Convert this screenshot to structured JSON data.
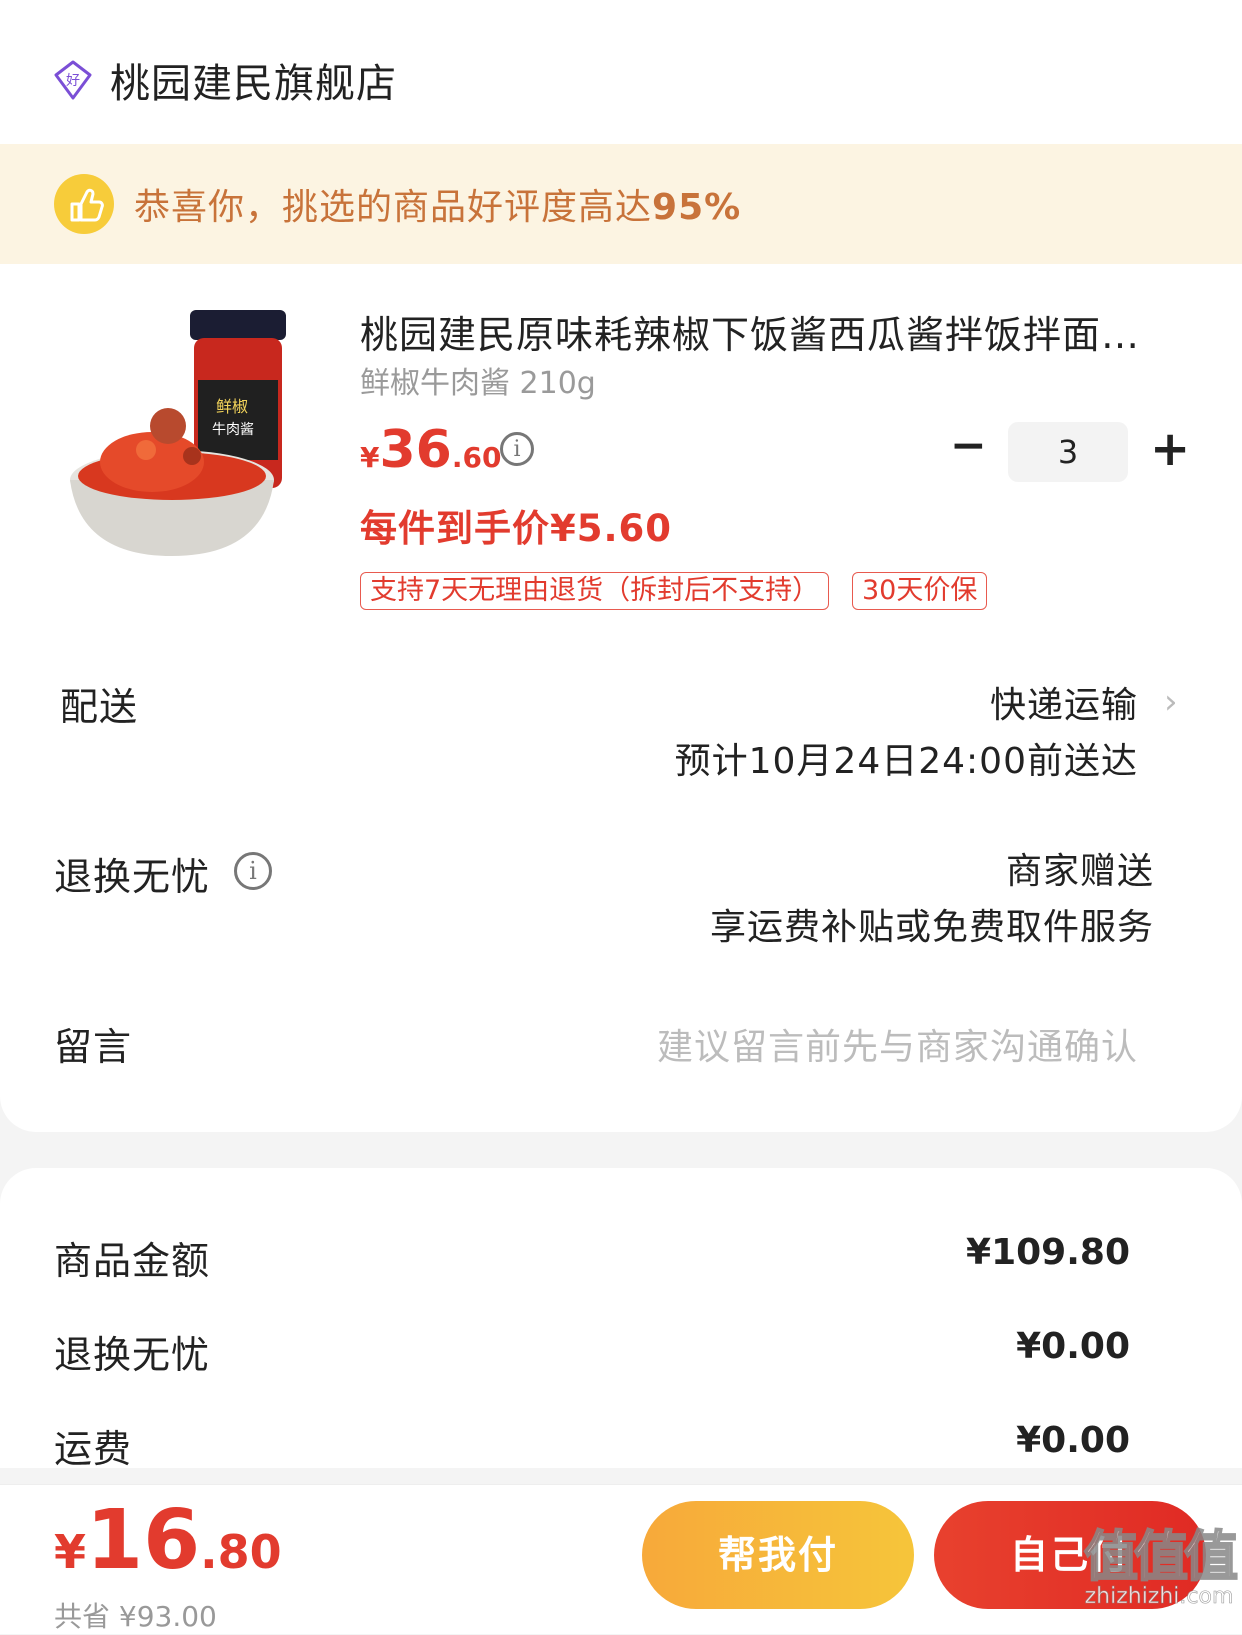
{
  "store": {
    "name": "桃园建民旗舰店",
    "icon": "store-badge-icon"
  },
  "banner": {
    "text": "恭喜你，挑选的商品好评度高达",
    "percent": "95%",
    "icon": "thumbs-up-icon"
  },
  "product": {
    "title": "桃园建民原味耗辣椒下饭酱西瓜酱拌饭拌面…",
    "spec": "鲜椒牛肉酱 210g",
    "price_symbol": "¥",
    "price_int": "36",
    "price_dec": ".60",
    "unit_price": "每件到手价¥5.60",
    "quantity": "3",
    "minus": "−",
    "plus": "+",
    "tags": [
      "支持7天无理由退货（拆封后不支持）",
      "30天价保"
    ]
  },
  "delivery": {
    "label": "配送",
    "method": "快递运输",
    "eta": "预计10月24日24:00前送达"
  },
  "returns": {
    "label": "退换无忧",
    "value1": "商家赠送",
    "value2": "享运费补贴或免费取件服务"
  },
  "message": {
    "label": "留言",
    "placeholder": "建议留言前先与商家沟通确认"
  },
  "summary": {
    "items": [
      {
        "label": "商品金额",
        "value": "¥109.80"
      },
      {
        "label": "退换无忧",
        "value": "¥0.00"
      },
      {
        "label": "运费",
        "value": "¥0.00"
      }
    ]
  },
  "footer": {
    "total_symbol": "¥",
    "total_int": "16",
    "total_dec": ".80",
    "saved": "共省 ¥93.00",
    "help_pay": "帮我付",
    "self_pay": "自己付"
  },
  "watermark": {
    "main": "值值值",
    "sub": "zhizhizhi.com"
  },
  "colors": {
    "accent_red": "#e23b2e",
    "accent_orange": "#f7a93a",
    "banner_bg": "#fcf4e2",
    "banner_text": "#c8733a"
  }
}
